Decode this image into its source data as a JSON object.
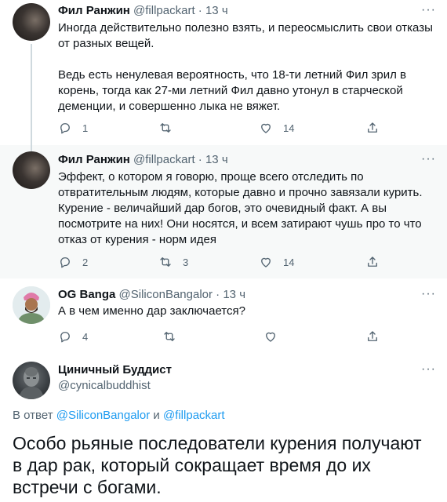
{
  "tweets": [
    {
      "name": "Фил Ранжин",
      "handle": "@fillpackart",
      "dot": "·",
      "time": "13 ч",
      "p1": "Иногда действительно полезно взять, и переосмыслить свои отказы от разных вещей.",
      "p2": "Ведь есть ненулевая вероятность, что 18-ти летний Фил зрил в корень, тогда как 27-ми летний Фил давно утонул в старческой деменции, и совершенно лыка не вяжет.",
      "replies": "1",
      "retweets": "",
      "likes": "14"
    },
    {
      "name": "Фил Ранжин",
      "handle": "@fillpackart",
      "dot": "·",
      "time": "13 ч",
      "p1": "Эффект, о котором я говорю, проще всего отследить по отвратительным людям, которые давно и прочно завязали курить. Курение - величайший дар богов, это очевидный факт. А вы посмотрите на них! Они носятся, и всем затирают чушь про то что отказ от курения - норм идея",
      "replies": "2",
      "retweets": "3",
      "likes": "14"
    },
    {
      "name": "OG Banga",
      "handle": "@SiliconBangalor",
      "dot": "·",
      "time": "13 ч",
      "p1": "А в чем именно дар заключается?",
      "replies": "4",
      "retweets": "",
      "likes": ""
    }
  ],
  "main": {
    "name": "Циничный Буддист",
    "handle": "@cynicalbuddhist",
    "reply_prefix": "В ответ",
    "reply_user1": "@SiliconBangalor",
    "reply_and": "и",
    "reply_user2": "@fillpackart",
    "text": "Особо рьяные последователи курения получают в дар рак, который сокращает время до их встречи с богами."
  },
  "more_glyph": "···",
  "icons": [
    "reply-icon",
    "retweet-icon",
    "like-icon",
    "share-icon",
    "more-icon"
  ],
  "colors": {
    "accent": "#1d9bf0",
    "muted": "#536471",
    "highlight_bg": "#f7f9f9",
    "text": "#0f1419"
  }
}
